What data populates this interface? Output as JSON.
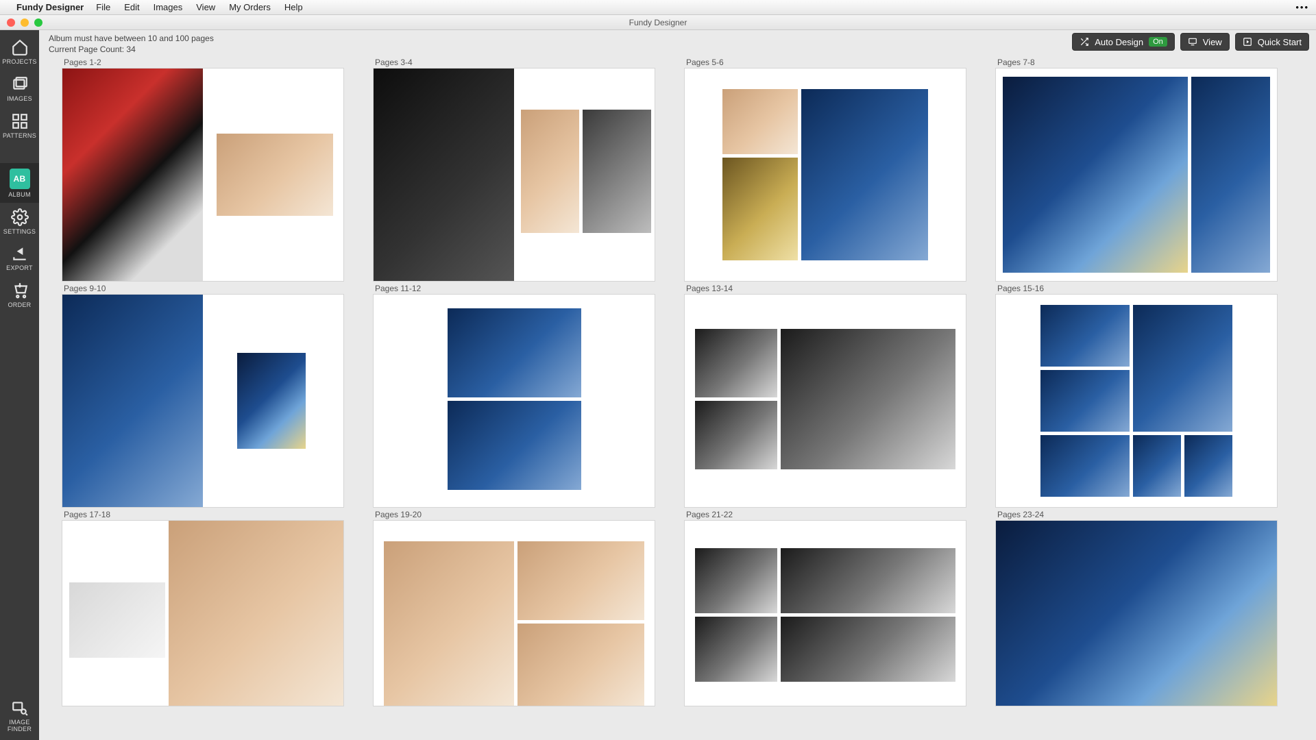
{
  "menu": {
    "app_name": "Fundy Designer",
    "items": [
      "File",
      "Edit",
      "Images",
      "View",
      "My Orders",
      "Help"
    ]
  },
  "window": {
    "title": "Fundy Designer"
  },
  "sidebar": {
    "items": [
      {
        "id": "projects",
        "label": "PROJECTS"
      },
      {
        "id": "images",
        "label": "IMAGES"
      },
      {
        "id": "patterns",
        "label": "PATTERNS"
      },
      {
        "id": "album",
        "label": "ALBUM",
        "active": true,
        "badge": "AB"
      },
      {
        "id": "settings",
        "label": "SETTINGS"
      },
      {
        "id": "export",
        "label": "EXPORT"
      },
      {
        "id": "order",
        "label": "ORDER"
      }
    ],
    "finder": {
      "line1": "IMAGE",
      "line2": "FINDER"
    }
  },
  "info": {
    "constraint": "Album must have between 10 and 100 pages",
    "count": "Current Page Count: 34"
  },
  "buttons": {
    "auto_design": "Auto Design",
    "auto_design_state": "On",
    "view": "View",
    "quick_start": "Quick Start"
  },
  "spreads": [
    {
      "label": "Pages 1-2",
      "layout": "l1"
    },
    {
      "label": "Pages 3-4",
      "layout": "l2"
    },
    {
      "label": "Pages 5-6",
      "layout": "l3"
    },
    {
      "label": "Pages 7-8",
      "layout": "l4"
    },
    {
      "label": "Pages 9-10",
      "layout": "l5"
    },
    {
      "label": "Pages 11-12",
      "layout": "l6"
    },
    {
      "label": "Pages 13-14",
      "layout": "l7"
    },
    {
      "label": "Pages 15-16",
      "layout": "l8"
    },
    {
      "label": "Pages 17-18",
      "layout": "l9"
    },
    {
      "label": "Pages 19-20",
      "layout": "l10"
    },
    {
      "label": "Pages 21-22",
      "layout": "l11"
    },
    {
      "label": "Pages 23-24",
      "layout": "l12"
    }
  ]
}
